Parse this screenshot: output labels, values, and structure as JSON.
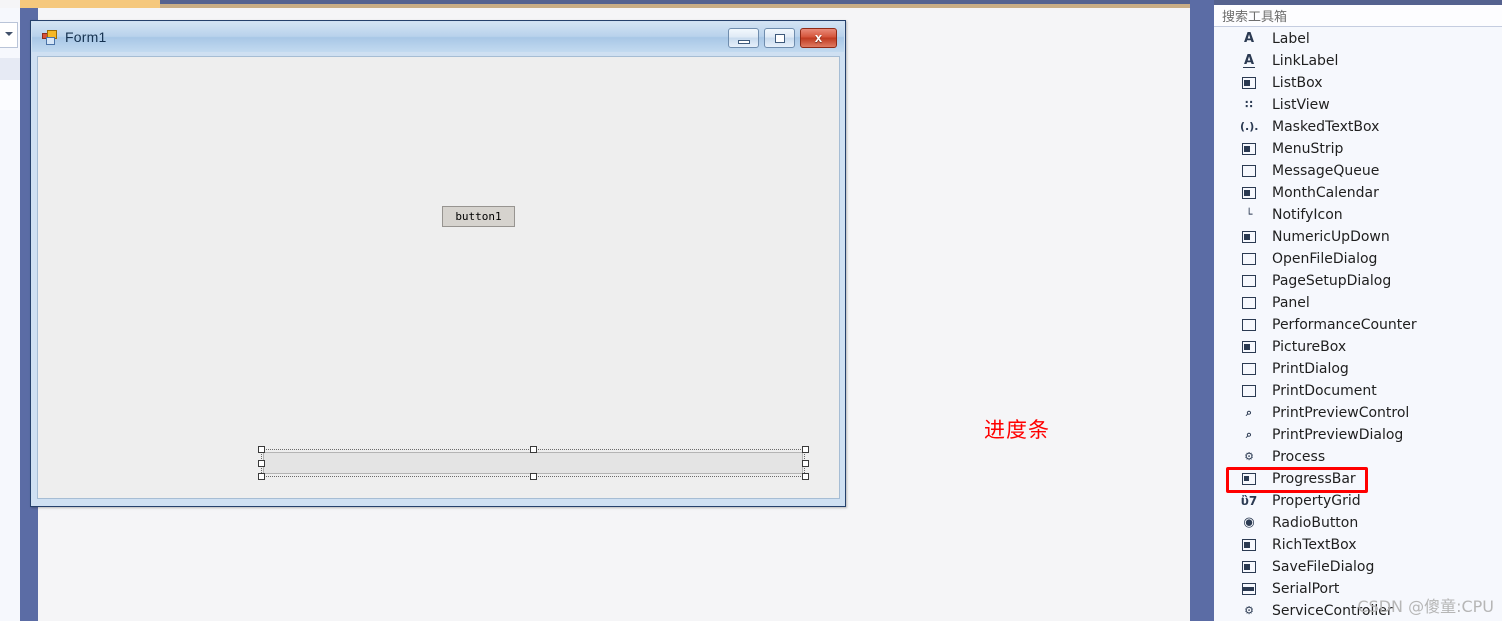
{
  "ide": {
    "active_tab_accent": "#f5c87d",
    "rail_color": "#5b6ca5"
  },
  "form_designer": {
    "title": "Form1",
    "icon": "windows-form-icon",
    "window_buttons": {
      "minimize": "minimize-icon",
      "maximize": "maximize-icon",
      "close": "x"
    },
    "controls": {
      "button1": {
        "text": "button1"
      },
      "progressbar1": {
        "selected": true,
        "handle_count": 8
      }
    }
  },
  "annotation": {
    "text": "进度条",
    "color": "#ff0000"
  },
  "toolbox": {
    "search": {
      "placeholder": "搜索工具箱",
      "value": ""
    },
    "highlight": {
      "item": "ProgressBar",
      "color": "#ff0000"
    },
    "items": [
      {
        "label": "Label",
        "icon": "label-icon"
      },
      {
        "label": "LinkLabel",
        "icon": "linklabel-icon"
      },
      {
        "label": "ListBox",
        "icon": "listbox-icon"
      },
      {
        "label": "ListView",
        "icon": "listview-icon"
      },
      {
        "label": "MaskedTextBox",
        "icon": "maskedtextbox-icon"
      },
      {
        "label": "MenuStrip",
        "icon": "menustrip-icon"
      },
      {
        "label": "MessageQueue",
        "icon": "messagequeue-icon"
      },
      {
        "label": "MonthCalendar",
        "icon": "monthcalendar-icon"
      },
      {
        "label": "NotifyIcon",
        "icon": "notifyicon-icon"
      },
      {
        "label": "NumericUpDown",
        "icon": "numericupdown-icon"
      },
      {
        "label": "OpenFileDialog",
        "icon": "openfiledialog-icon"
      },
      {
        "label": "PageSetupDialog",
        "icon": "pagesetupdialog-icon"
      },
      {
        "label": "Panel",
        "icon": "panel-icon"
      },
      {
        "label": "PerformanceCounter",
        "icon": "performancecounter-icon"
      },
      {
        "label": "PictureBox",
        "icon": "picturebox-icon"
      },
      {
        "label": "PrintDialog",
        "icon": "printdialog-icon"
      },
      {
        "label": "PrintDocument",
        "icon": "printdocument-icon"
      },
      {
        "label": "PrintPreviewControl",
        "icon": "printpreviewcontrol-icon"
      },
      {
        "label": "PrintPreviewDialog",
        "icon": "printpreviewdialog-icon"
      },
      {
        "label": "Process",
        "icon": "process-icon"
      },
      {
        "label": "ProgressBar",
        "icon": "progressbar-icon"
      },
      {
        "label": "PropertyGrid",
        "icon": "propertygrid-icon"
      },
      {
        "label": "RadioButton",
        "icon": "radiobutton-icon"
      },
      {
        "label": "RichTextBox",
        "icon": "richtextbox-icon"
      },
      {
        "label": "SaveFileDialog",
        "icon": "savefiledialog-icon"
      },
      {
        "label": "SerialPort",
        "icon": "serialport-icon"
      },
      {
        "label": "ServiceController",
        "icon": "servicecontroller-icon"
      }
    ]
  },
  "watermark": {
    "text": "CSDN @傻童:CPU"
  }
}
